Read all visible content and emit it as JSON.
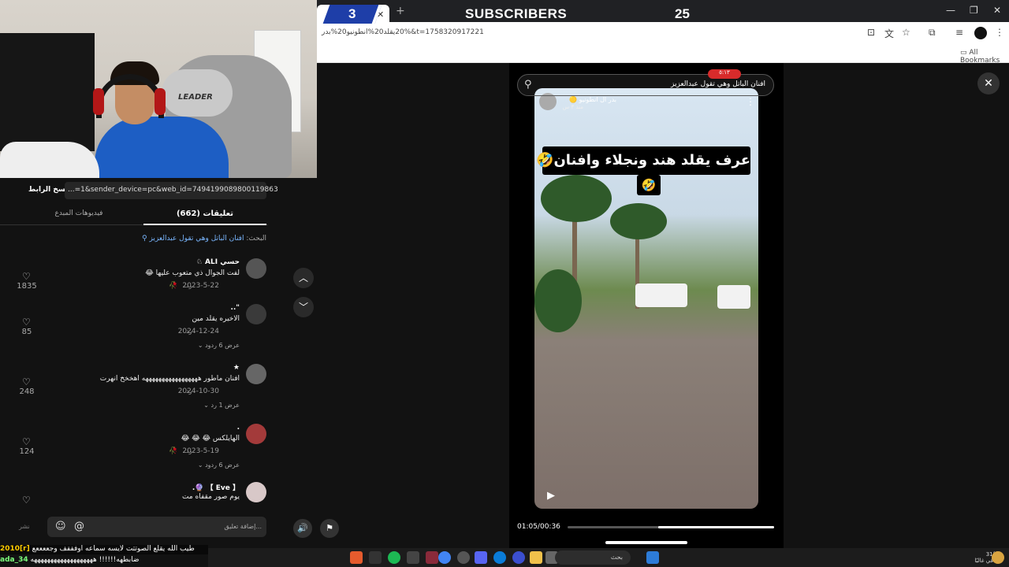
{
  "browser": {
    "url": "‏20%يقلد20%انطونيو20%بدر&t=1758320917221",
    "bookmarks_label": "All Bookmarks"
  },
  "stream_overlay": {
    "subscribers_count": "3",
    "subscribers_label": "SUBSCRIBERS",
    "subscribers_goal": "25"
  },
  "webcam": {
    "chair_brand": "LEADER"
  },
  "share": {
    "url_text": "...=1&sender_device=pc&web_id=7494199089800119863",
    "copy_link": "نسخ الرابط"
  },
  "tabs": {
    "comments": "(662) تعليقات",
    "creator_videos": "فيديوهات المبدع"
  },
  "search_hint": {
    "prefix": "البحث:",
    "query": "افنان الباتل وهي تقول عبدالعزيز"
  },
  "comments": [
    {
      "user": "حسي ALI ♘",
      "text": "لفت الجوال ذي متعوب عليها 😂",
      "date": "2023-5-22",
      "reply": "رد",
      "badge": "🥀",
      "likes": "1835",
      "more": ""
    },
    {
      "user": "\"..",
      "text": "الاخيره يقلد مين",
      "date": "2024-12-24",
      "reply": "رد",
      "badge": "",
      "likes": "85",
      "more": "عرض 6 ردود ⌄"
    },
    {
      "user": "★",
      "text": "افنان ماطور هههههههههههههههههه اهخخخ انهرت",
      "date": "2024-10-30",
      "reply": "رد",
      "badge": "",
      "likes": "248",
      "more": "عرض 1 رد ⌄"
    },
    {
      "user": ".",
      "text": "الهايلكس 😂 😂 😂",
      "date": "2023-5-19",
      "reply": "رد",
      "badge": "🥀",
      "likes": "124",
      "more": "عرض 6 ردود ⌄"
    },
    {
      "user": "【 Eve 】 🔮.",
      "text": "يوم صور مقفاه مت",
      "date": "",
      "reply": "",
      "badge": "",
      "likes": "",
      "more": ""
    }
  ],
  "comment_bar": {
    "placeholder": "إضافة تعليق...",
    "post": "نشر"
  },
  "video": {
    "search_text": "افنان الباتل وهي تقول عبدالعزيز",
    "rec_label": "٥:١٣",
    "author": "بدر ال انطونيو 🟡",
    "posted": "منذ ٣ س",
    "caption": "عرف يقلد هند ونجلاء وافنان🤣",
    "caption_emoji": "🤣",
    "time": "01:05/00:36",
    "progress": 0.56
  },
  "chat": {
    "line1_user": "2010[r]",
    "line1_text": "طيب الله يقلع الصوتتت لايسه سماعه اوفففف وجععععع",
    "line2_user": "ada_34",
    "line2_text": "ضابطهه!!!!!! هههههههههههههههههههه"
  },
  "taskbar": {
    "search": "بحث",
    "weather_temp": "31°C",
    "weather_desc": "صافي غالبًا"
  },
  "colors": {
    "subscriber_blue": "#1e3ea8",
    "link_blue": "#7ab7ff",
    "rec_red": "#d82b2b"
  }
}
